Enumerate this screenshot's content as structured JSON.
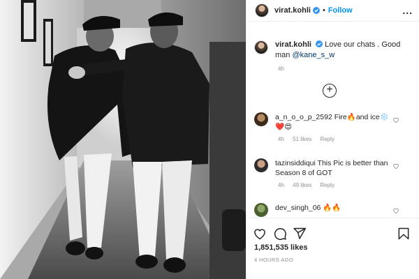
{
  "header": {
    "username": "virat.kohli",
    "separator": "•",
    "follow_label": "Follow",
    "more_label": "..."
  },
  "caption": {
    "username": "virat.kohli",
    "text": "Love our chats . Good man ",
    "mention": "@kane_s_w",
    "time": "4h"
  },
  "comments": [
    {
      "username": "a_n_o_o_p_2592",
      "text": "Fire🔥and ice❄️ ❤️😍",
      "time": "4h",
      "likes": "51 likes",
      "reply_label": "Reply"
    },
    {
      "username": "tazinsiddiqui",
      "text": "This Pic is better than Season 8 of GOT",
      "time": "4h",
      "likes": "49 likes",
      "reply_label": "Reply"
    },
    {
      "username": "dev_singh_06",
      "text": "🔥🔥"
    }
  ],
  "footer": {
    "likes": "1,851,535 likes",
    "time_ago": "4 HOURS AGO"
  },
  "colors": {
    "accent": "#0095f6",
    "mention": "#00376b",
    "muted": "#8e8e8e",
    "text": "#262626",
    "divider": "#efefef"
  },
  "icons": [
    "verified-icon",
    "more-icon",
    "add-circle-icon",
    "heart-icon",
    "comment-icon",
    "share-icon",
    "bookmark-icon"
  ]
}
